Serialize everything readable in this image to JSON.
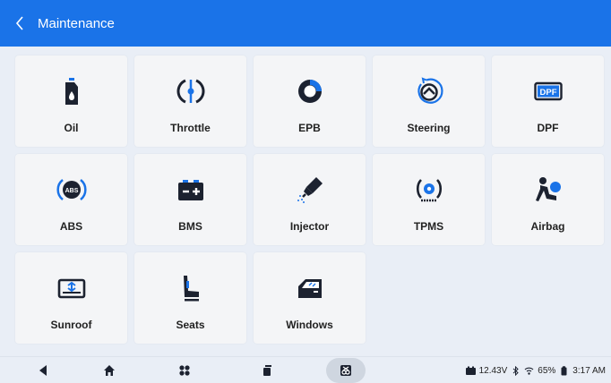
{
  "header": {
    "title": "Maintenance"
  },
  "tiles": [
    {
      "label": "Oil",
      "icon": "oil-bottle-icon"
    },
    {
      "label": "Throttle",
      "icon": "throttle-icon"
    },
    {
      "label": "EPB",
      "icon": "epb-icon"
    },
    {
      "label": "Steering",
      "icon": "steering-wheel-icon"
    },
    {
      "label": "DPF",
      "icon": "dpf-icon"
    },
    {
      "label": "ABS",
      "icon": "abs-icon"
    },
    {
      "label": "BMS",
      "icon": "battery-icon"
    },
    {
      "label": "Injector",
      "icon": "injector-icon"
    },
    {
      "label": "TPMS",
      "icon": "tpms-icon"
    },
    {
      "label": "Airbag",
      "icon": "airbag-icon"
    },
    {
      "label": "Sunroof",
      "icon": "sunroof-icon"
    },
    {
      "label": "Seats",
      "icon": "seat-icon"
    },
    {
      "label": "Windows",
      "icon": "car-window-icon"
    }
  ],
  "dpf_text": "DPF",
  "abs_text": "ABS",
  "status": {
    "voltage": "12.43V",
    "battery": "65%",
    "time": "3:17 AM"
  },
  "colors": {
    "accent": "#1a73e8",
    "icon_dark": "#1c2230",
    "background": "#e9eef6",
    "tile": "#f4f5f7"
  }
}
